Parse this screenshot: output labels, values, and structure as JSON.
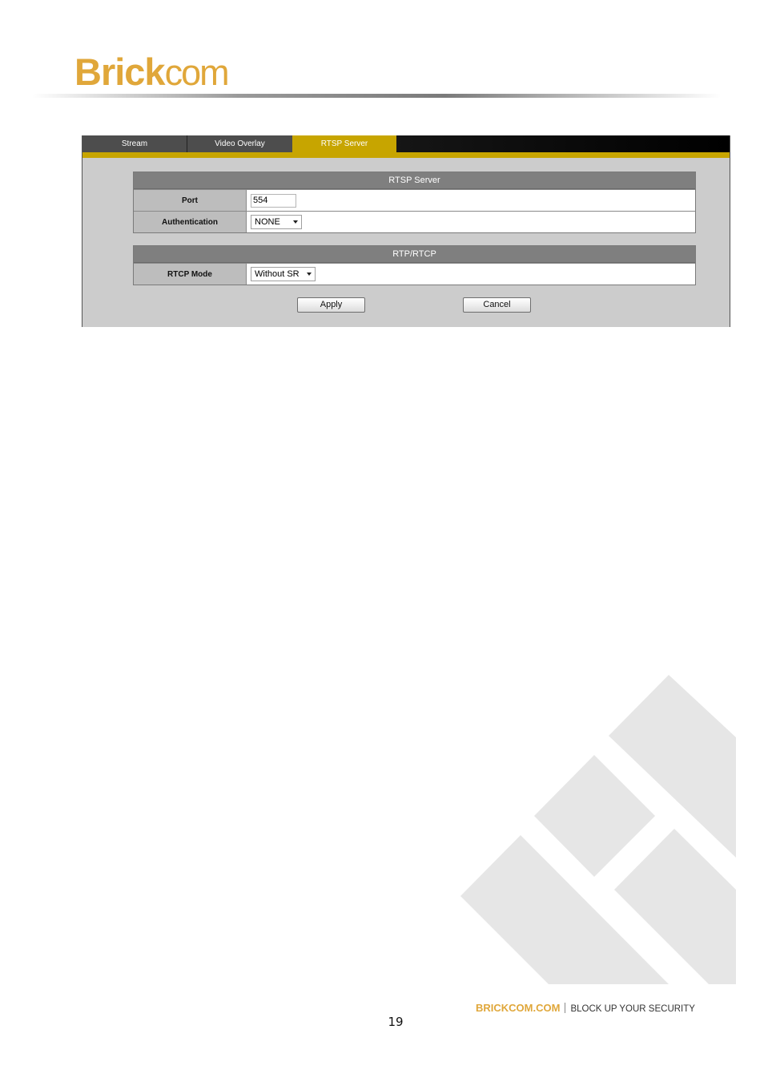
{
  "header": {
    "logo_bold": "Brick",
    "logo_light": "com"
  },
  "tabs": [
    {
      "label": "Stream"
    },
    {
      "label": "Video Overlay"
    },
    {
      "label": "RTSP Server",
      "active": true
    }
  ],
  "rtsp_section": {
    "title": "RTSP Server",
    "port_label": "Port",
    "port_value": "554",
    "auth_label": "Authentication",
    "auth_value": "NONE"
  },
  "rtp_section": {
    "title": "RTP/RTCP",
    "rtcp_label": "RTCP Mode",
    "rtcp_value": "Without SR"
  },
  "buttons": {
    "apply": "Apply",
    "cancel": "Cancel"
  },
  "footer": {
    "brand": "BRICKCOM.COM",
    "tagline": "BLOCK UP YOUR SECURITY",
    "page_number": "19"
  },
  "colors": {
    "accent": "#c7a500",
    "logo": "#e0a73a",
    "watermark": "#e6e6e6"
  }
}
